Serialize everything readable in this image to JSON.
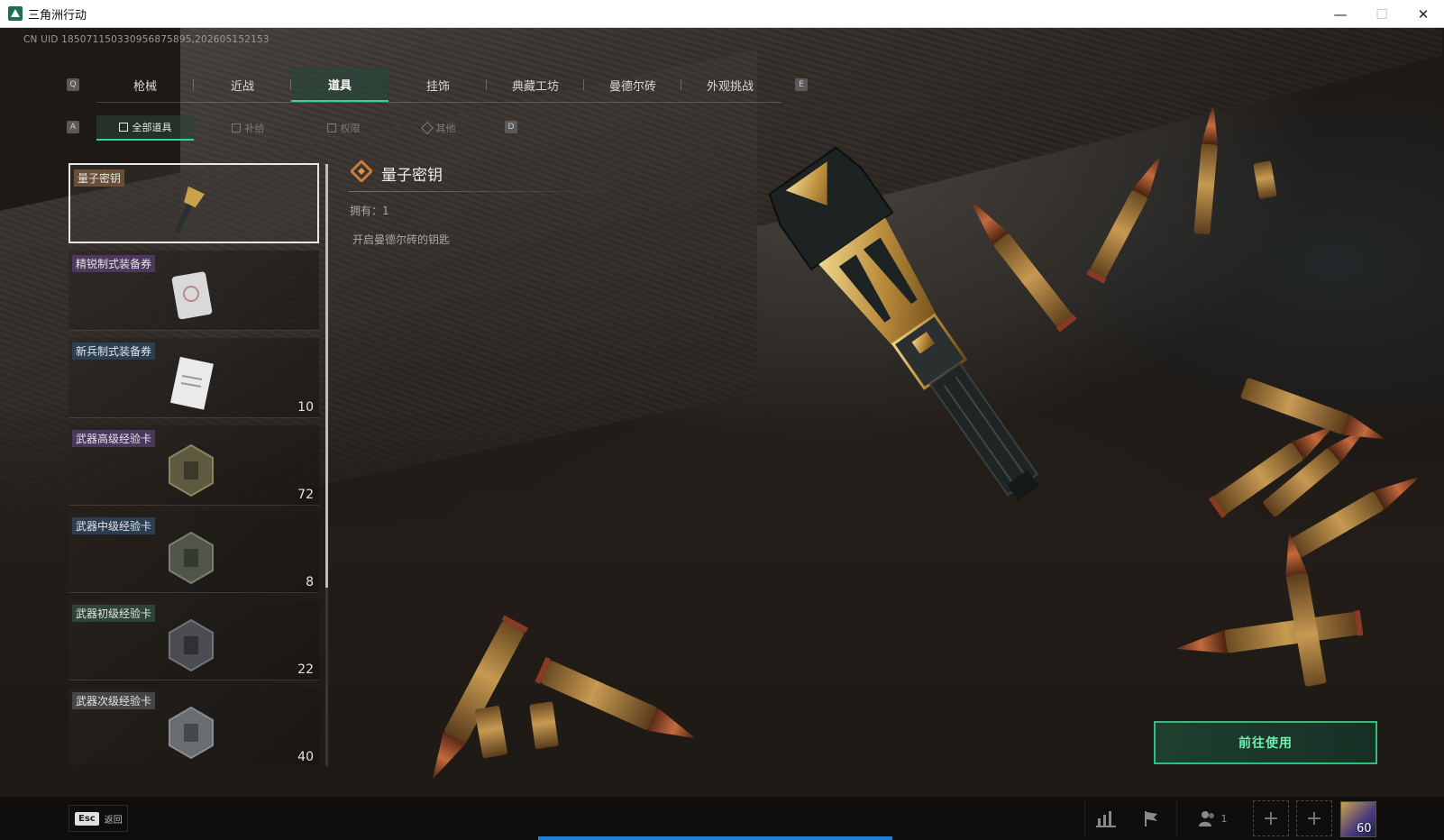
{
  "window": {
    "title": "三角洲行动",
    "minimize": "—",
    "maximize": "☐",
    "close": "✕"
  },
  "uid_text": "CN UID 18507115033095687589​5,202605152153",
  "key_hints": {
    "prev_tab": "Q",
    "next_tab": "E",
    "prev_sub": "A",
    "next_sub": "D"
  },
  "tabs": [
    {
      "label": "枪械"
    },
    {
      "label": "近战"
    },
    {
      "label": "道具",
      "active": true
    },
    {
      "label": "挂饰"
    },
    {
      "label": "典藏工坊"
    },
    {
      "label": "曼德尔砖"
    },
    {
      "label": "外观挑战"
    }
  ],
  "subtabs": [
    {
      "label": "全部道具",
      "active": true
    },
    {
      "label": "补给"
    },
    {
      "label": "权限"
    },
    {
      "label": "其他"
    }
  ],
  "items": [
    {
      "name": "量子密钥",
      "count": "",
      "rarity": "gold",
      "selected": true
    },
    {
      "name": "精锐制式装备券",
      "count": "",
      "rarity": "purple"
    },
    {
      "name": "新兵制式装备券",
      "count": "10",
      "rarity": "blue"
    },
    {
      "name": "武器高级经验卡",
      "count": "72",
      "rarity": "purple"
    },
    {
      "name": "武器中级经验卡",
      "count": "8",
      "rarity": "blue"
    },
    {
      "name": "武器初级经验卡",
      "count": "22",
      "rarity": "green"
    },
    {
      "name": "武器次级经验卡",
      "count": "40",
      "rarity": "gray"
    }
  ],
  "detail": {
    "title": "量子密钥",
    "owned": "拥有：1",
    "description": "开启曼德尔砖的钥匙",
    "use_button": "前往使用"
  },
  "bottom": {
    "esc_key": "Esc",
    "back_label": "返回",
    "squad_count": "1",
    "level": "60"
  },
  "colors": {
    "accent_green": "#39d28b",
    "button_text": "#6ff0b0",
    "progress_blue": "#1f7fd6"
  },
  "icons": [
    "app-icon",
    "stats-icon",
    "flag-icon",
    "friends-icon",
    "plus-icon",
    "avatar"
  ]
}
